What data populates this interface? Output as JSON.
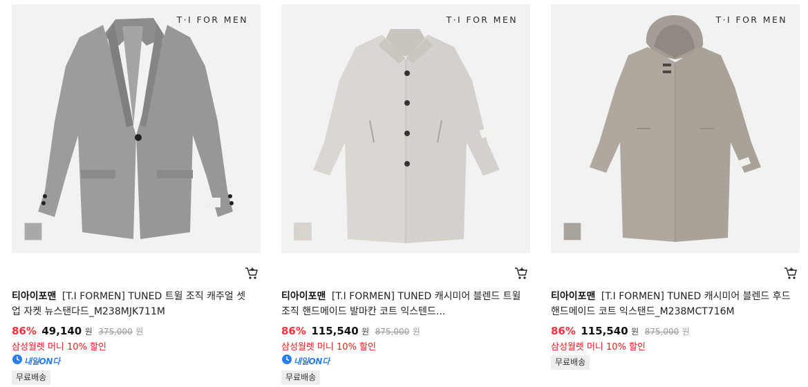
{
  "products": [
    {
      "brand_mark": "T·I FOR MEN",
      "swatch_color": "#a9a9a7",
      "garment": "blazer",
      "garment_color": "#9a9a98",
      "brand": "티아이포맨",
      "name": "[T.I FORMEN] TUNED 트윌 조직 캐주얼 셋업 자켓 뉴스탠다드_M238MJK711M",
      "discount_rate": "86%",
      "sale_price": "49,140",
      "currency": "원",
      "original_price": "375,000",
      "promo": "삼성월렛 머니 10% 할인",
      "next_day_label": "내일ON다",
      "shipping": "무료배송"
    },
    {
      "brand_mark": "T·I FOR MEN",
      "swatch_color": "#d8d3cc",
      "garment": "balmacaan",
      "garment_color": "#d9d5d0",
      "brand": "티아이포맨",
      "name": "[T.I FORMEN] TUNED 캐시미어 블렌드 트윌 조직 핸드메이드 발마칸 코트 익스텐드...",
      "discount_rate": "86%",
      "sale_price": "115,540",
      "currency": "원",
      "original_price": "875,000",
      "promo": "삼성월렛 머니 10% 할인",
      "next_day_label": "내일ON다",
      "shipping": "무료배송"
    },
    {
      "brand_mark": "T·I FOR MEN",
      "swatch_color": "#a8a49d",
      "garment": "hooded-coat",
      "garment_color": "#aca69e",
      "brand": "티아이포맨",
      "name": "[T.I FORMEN] TUNED 캐시미어 블렌드 후드 핸드메이드 코트 익스탠드_M238MCT716M",
      "discount_rate": "86%",
      "sale_price": "115,540",
      "currency": "원",
      "original_price": "875,000",
      "promo": "삼성월렛 머니 10% 할인",
      "shipping": "무료배송"
    }
  ],
  "colors": {
    "discount": "#ff2f3b",
    "promo": "#e0201f",
    "next_day": "#2c7fe8"
  },
  "icons": {
    "cart": "cart-icon",
    "next_day": "clock-badge-icon"
  }
}
